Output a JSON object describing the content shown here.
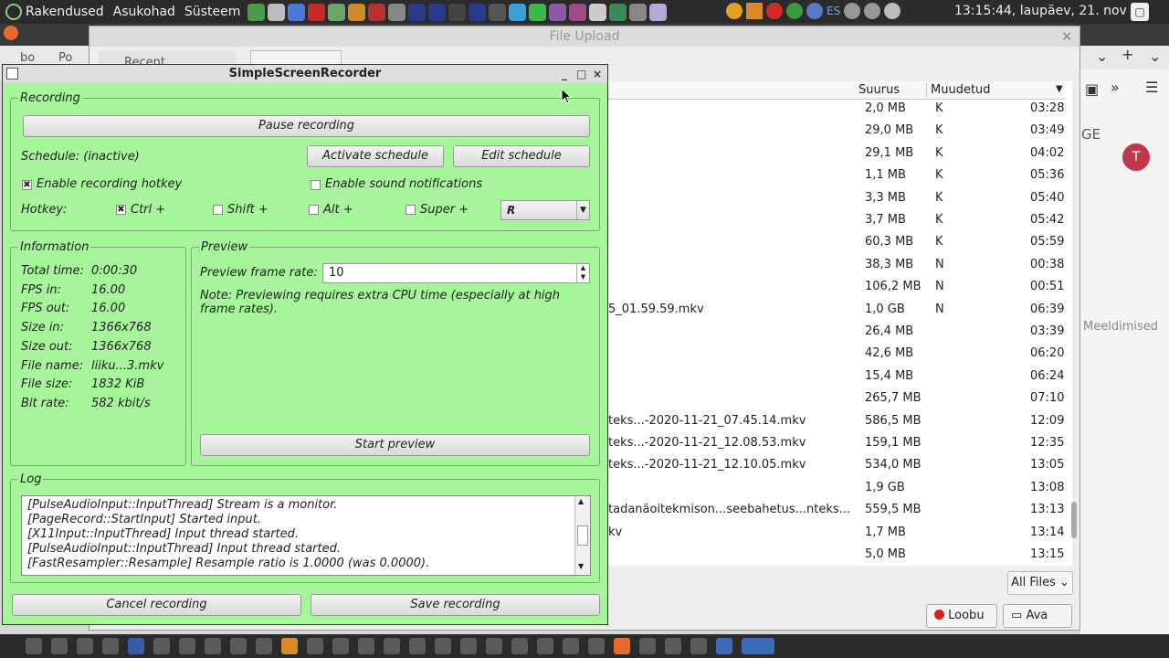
{
  "top_panel": {
    "menus": [
      "Rakendused",
      "Asukohad",
      "Süsteem"
    ],
    "clock": "13:15:44, laupäev, 21. nov",
    "lang": "ES"
  },
  "browser": {
    "tab1": "bo",
    "tab2": "Po",
    "recent": "Recent",
    "side_text": "GE",
    "avatar_letter": "T",
    "side_label": "Meeldimised"
  },
  "file_upload": {
    "title": "File Upload",
    "col_size": "Suurus",
    "col_modified": "Muudetud",
    "rows": [
      {
        "name": "",
        "size": "2,0 MB",
        "flag": "K",
        "time": "03:28"
      },
      {
        "name": "",
        "size": "29,0 MB",
        "flag": "K",
        "time": "03:49"
      },
      {
        "name": "",
        "size": "29,1 MB",
        "flag": "K",
        "time": "04:02"
      },
      {
        "name": "",
        "size": "1,1 MB",
        "flag": "K",
        "time": "05:36"
      },
      {
        "name": "",
        "size": "3,3 MB",
        "flag": "K",
        "time": "05:40"
      },
      {
        "name": "",
        "size": "3,7 MB",
        "flag": "K",
        "time": "05:42"
      },
      {
        "name": "",
        "size": "60,3 MB",
        "flag": "K",
        "time": "05:59"
      },
      {
        "name": "",
        "size": "38,3 MB",
        "flag": "N",
        "time": "00:38"
      },
      {
        "name": "",
        "size": "106,2 MB",
        "flag": "N",
        "time": "00:51"
      },
      {
        "name": "5_01.59.59.mkv",
        "size": "1,0 GB",
        "flag": "N",
        "time": "06:39"
      },
      {
        "name": "",
        "size": "26,4 MB",
        "flag": "",
        "time": "03:39"
      },
      {
        "name": "",
        "size": "42,6 MB",
        "flag": "",
        "time": "06:20"
      },
      {
        "name": "",
        "size": "15,4 MB",
        "flag": "",
        "time": "06:24"
      },
      {
        "name": "",
        "size": "265,7 MB",
        "flag": "",
        "time": "07:10"
      },
      {
        "name": "teks...-2020-11-21_07.45.14.mkv",
        "size": "586,5 MB",
        "flag": "",
        "time": "12:09"
      },
      {
        "name": "teks...-2020-11-21_12.08.53.mkv",
        "size": "159,1 MB",
        "flag": "",
        "time": "12:35"
      },
      {
        "name": "teks...-2020-11-21_12.10.05.mkv",
        "size": "534,0 MB",
        "flag": "",
        "time": "13:05"
      },
      {
        "name": "",
        "size": "1,9 GB",
        "flag": "",
        "time": "13:08"
      },
      {
        "name": "tadanäoitekmison...seebahetus...nteks...",
        "size": "559,5 MB",
        "flag": "",
        "time": "13:13"
      },
      {
        "name": "kv",
        "size": "1,7 MB",
        "flag": "",
        "time": "13:14"
      },
      {
        "name": "",
        "size": "5,0 MB",
        "flag": "",
        "time": "13:15"
      }
    ],
    "filter": "All Files",
    "cancel": "Loobu",
    "open": "Ava"
  },
  "ssr": {
    "title": "SimpleScreenRecorder",
    "recording_label": "Recording",
    "pause": "Pause recording",
    "schedule": "Schedule: (inactive)",
    "activate": "Activate schedule",
    "edit": "Edit schedule",
    "enable_hotkey": "Enable recording hotkey",
    "enable_sound": "Enable sound notifications",
    "hotkey_label": "Hotkey:",
    "ctrl": "Ctrl +",
    "shift": "Shift +",
    "alt": "Alt +",
    "super": "Super +",
    "key": "R",
    "info_label": "Information",
    "info": [
      {
        "k": "Total time:",
        "v": "0:00:30"
      },
      {
        "k": "FPS in:",
        "v": "16.00"
      },
      {
        "k": "FPS out:",
        "v": "16.00"
      },
      {
        "k": "Size in:",
        "v": "1366x768"
      },
      {
        "k": "Size out:",
        "v": "1366x768"
      },
      {
        "k": "File name:",
        "v": "liiku...3.mkv"
      },
      {
        "k": "File size:",
        "v": "1832 KiB"
      },
      {
        "k": "Bit rate:",
        "v": "582 kbit/s"
      }
    ],
    "preview_label": "Preview",
    "preview_rate_label": "Preview frame rate:",
    "preview_rate": "10",
    "preview_note": "Note: Previewing requires extra CPU time (especially at high frame rates).",
    "start_preview": "Start preview",
    "log_label": "Log",
    "log": [
      "[PulseAudioInput::InputThread] Stream is a monitor.",
      "[PageRecord::StartInput] Started input.",
      "[X11Input::InputThread] Input thread started.",
      "[PulseAudioInput::InputThread] Input thread started.",
      "[FastResampler::Resample] Resample ratio is 1.0000 (was 0.0000)."
    ],
    "cancel": "Cancel recording",
    "save": "Save recording"
  }
}
